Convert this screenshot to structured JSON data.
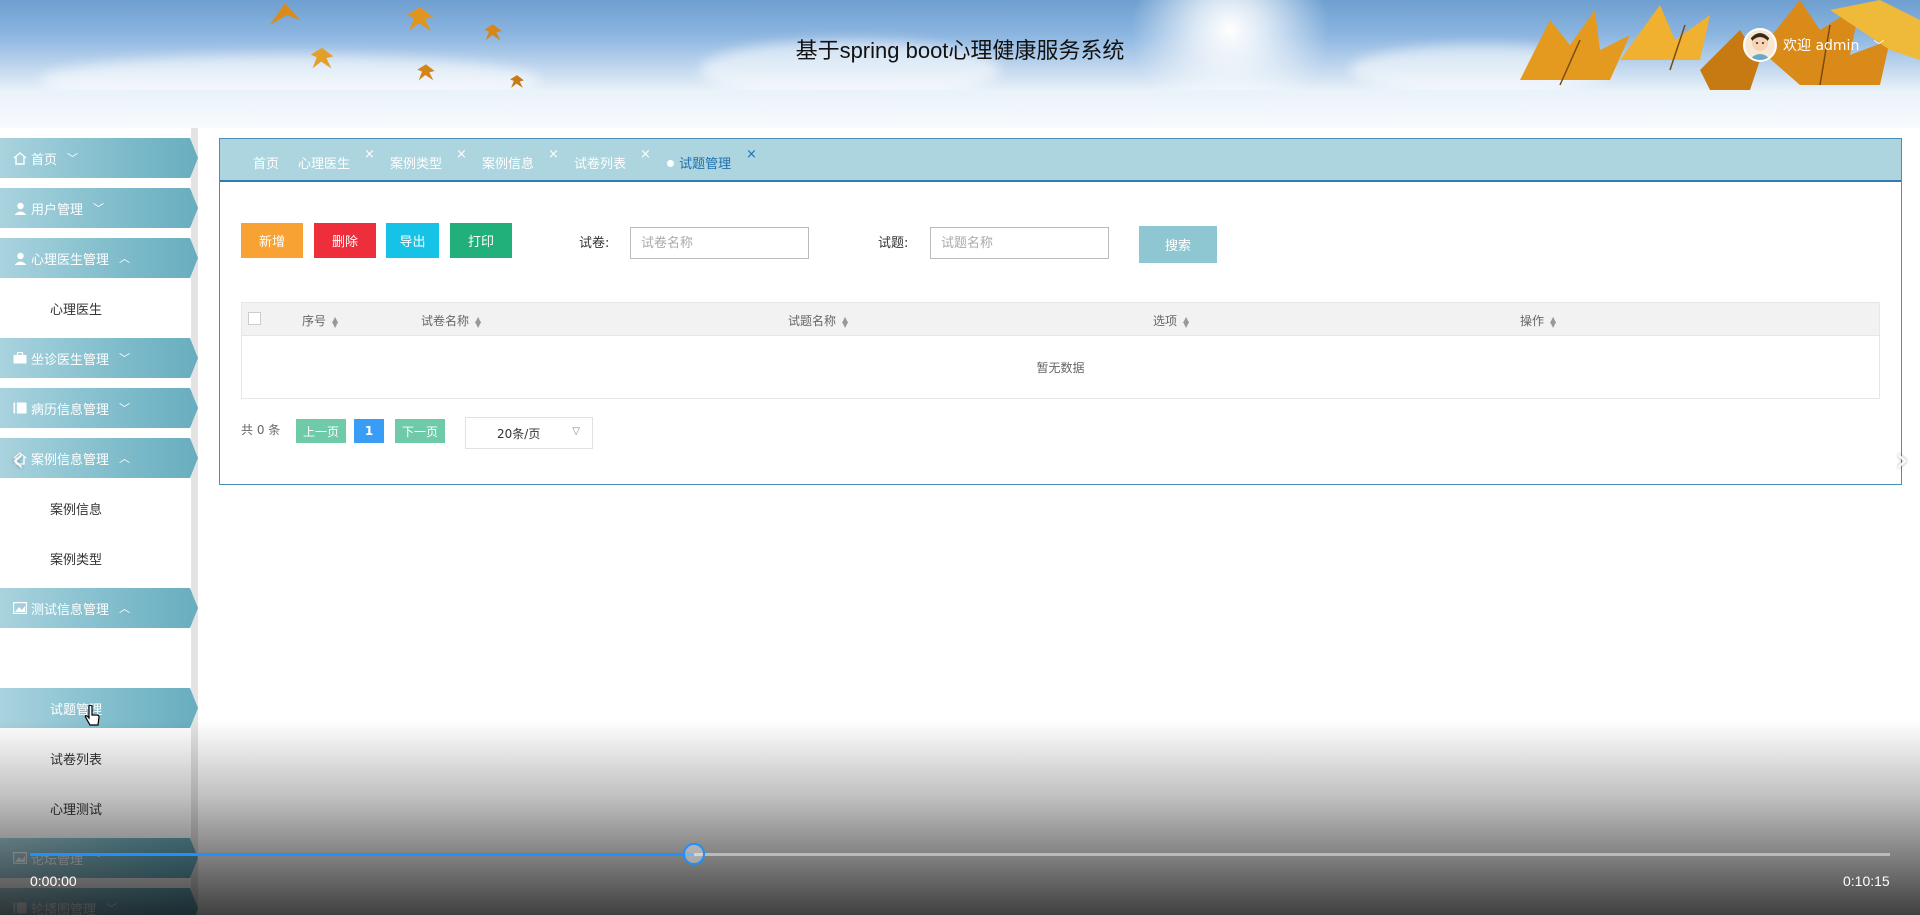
{
  "header": {
    "title": "基于spring boot心理健康服务系统",
    "welcome": "欢迎 admin",
    "caret": "﹀"
  },
  "sidebar": {
    "items": [
      {
        "label": "首页",
        "icon": "home-icon",
        "chevron": "﹀"
      },
      {
        "label": "用户管理",
        "icon": "user-icon",
        "chevron": "﹀"
      },
      {
        "label": "心理医生管理",
        "icon": "user-icon",
        "chevron": "︿"
      },
      {
        "label": "心理医生"
      },
      {
        "label": "坐诊医生管理",
        "icon": "briefcase-icon",
        "chevron": "﹀"
      },
      {
        "label": "病历信息管理",
        "icon": "book-icon",
        "chevron": "﹀"
      },
      {
        "label": "案例信息管理",
        "icon": "home-icon",
        "chevron": "︿"
      },
      {
        "label": "案例信息"
      },
      {
        "label": "案例类型"
      },
      {
        "label": "测试信息管理",
        "icon": "image-icon",
        "chevron": "︿"
      },
      {
        "label": "试题管理"
      },
      {
        "label": "试卷列表"
      },
      {
        "label": "心理测试"
      },
      {
        "label": "论坛管理",
        "icon": "image-icon",
        "chevron": "﹀"
      },
      {
        "label": "轮播图管理",
        "icon": "book-icon",
        "chevron": "﹀"
      }
    ]
  },
  "tabs": [
    {
      "label": "首页",
      "closable": false
    },
    {
      "label": "心理医生",
      "close": "×"
    },
    {
      "label": "案例类型",
      "close": "×"
    },
    {
      "label": "案例信息",
      "close": "×"
    },
    {
      "label": "试卷列表",
      "close": "×"
    },
    {
      "label": "试题管理",
      "close": "×",
      "active": true
    }
  ],
  "toolbar": {
    "add": "新增",
    "delete": "删除",
    "export": "导出",
    "print": "打印",
    "paper_label": "试卷:",
    "paper_placeholder": "试卷名称",
    "question_label": "试题:",
    "question_placeholder": "试题名称",
    "search": "搜索"
  },
  "table": {
    "columns": [
      "序号",
      "试卷名称",
      "试题名称",
      "选项",
      "操作"
    ],
    "empty_text": "暂无数据"
  },
  "pager": {
    "total": "共 0 条",
    "prev": "上一页",
    "page": "1",
    "next": "下一页",
    "page_size": "20条/页"
  },
  "video": {
    "current_time": "0:00:00",
    "duration": "0:10:15",
    "progress": 0.357
  },
  "colors": {
    "add": "#f7a233",
    "delete": "#ee2e3b",
    "export": "#16c3e6",
    "print": "#22b07a",
    "search": "#8ec6d2",
    "pager": "#6fcaa8",
    "page_active": "#3a9df5",
    "accent": "#2f7bb2"
  }
}
